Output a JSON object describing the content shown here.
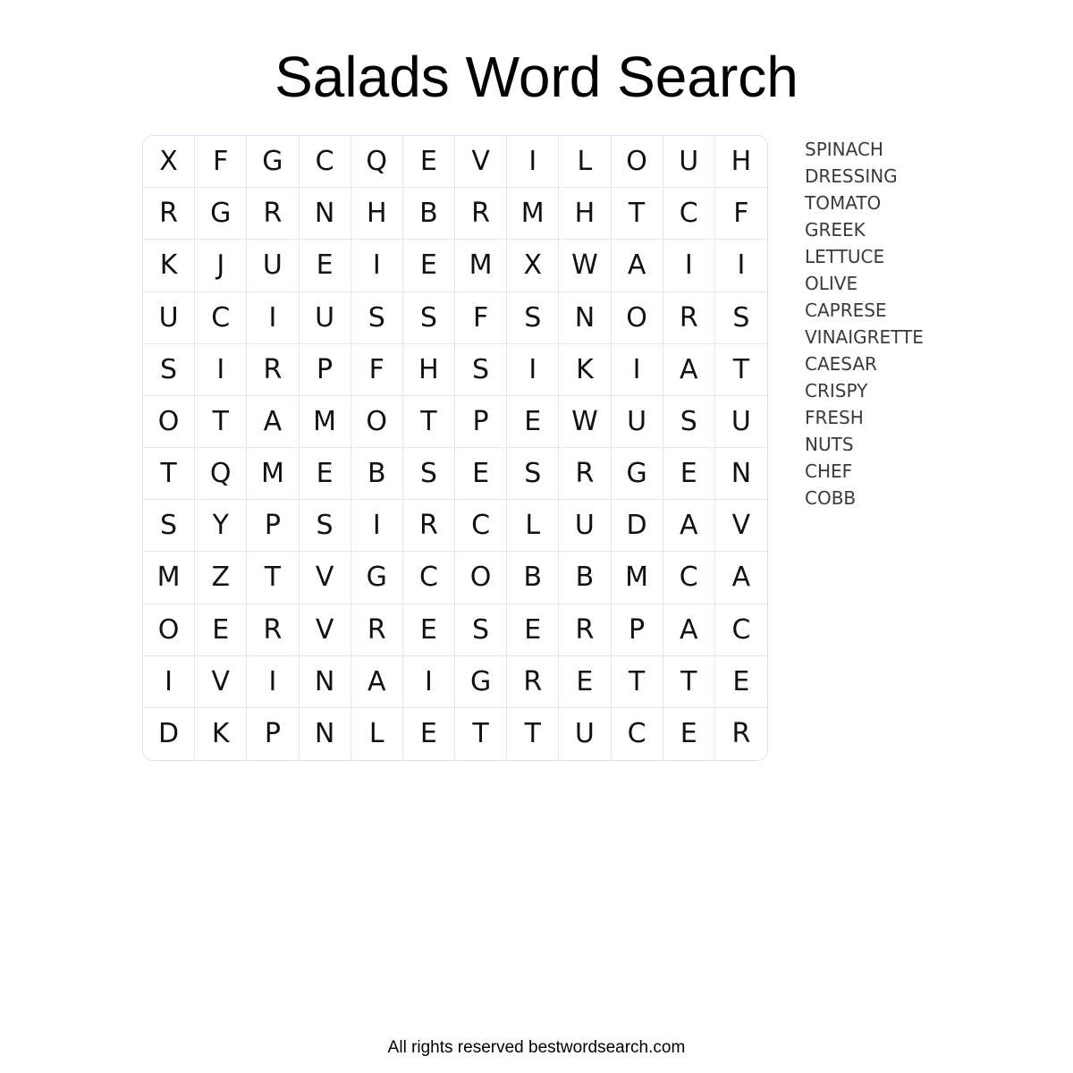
{
  "title": "Salads Word Search",
  "grid": [
    [
      "X",
      "F",
      "G",
      "C",
      "Q",
      "E",
      "V",
      "I",
      "L",
      "O",
      "U",
      "H"
    ],
    [
      "R",
      "G",
      "R",
      "N",
      "H",
      "B",
      "R",
      "M",
      "H",
      "T",
      "C",
      "F"
    ],
    [
      "K",
      "J",
      "U",
      "E",
      "I",
      "E",
      "M",
      "X",
      "W",
      "A",
      "I",
      "I"
    ],
    [
      "U",
      "C",
      "I",
      "U",
      "S",
      "S",
      "F",
      "S",
      "N",
      "O",
      "R",
      "S"
    ],
    [
      "S",
      "I",
      "R",
      "P",
      "F",
      "H",
      "S",
      "I",
      "K",
      "I",
      "A",
      "T"
    ],
    [
      "O",
      "T",
      "A",
      "M",
      "O",
      "T",
      "P",
      "E",
      "W",
      "U",
      "S",
      "U"
    ],
    [
      "T",
      "Q",
      "M",
      "E",
      "B",
      "S",
      "E",
      "S",
      "R",
      "G",
      "E",
      "N"
    ],
    [
      "S",
      "Y",
      "P",
      "S",
      "I",
      "R",
      "C",
      "L",
      "U",
      "D",
      "A",
      "V"
    ],
    [
      "M",
      "Z",
      "T",
      "V",
      "G",
      "C",
      "O",
      "B",
      "B",
      "M",
      "C",
      "A"
    ],
    [
      "O",
      "E",
      "R",
      "V",
      "R",
      "E",
      "S",
      "E",
      "R",
      "P",
      "A",
      "C"
    ],
    [
      "I",
      "V",
      "I",
      "N",
      "A",
      "I",
      "G",
      "R",
      "E",
      "T",
      "T",
      "E"
    ],
    [
      "D",
      "K",
      "P",
      "N",
      "L",
      "E",
      "T",
      "T",
      "U",
      "C",
      "E",
      "R"
    ]
  ],
  "words": [
    "SPINACH",
    "DRESSING",
    "TOMATO",
    "GREEK",
    "LETTUCE",
    "OLIVE",
    "CAPRESE",
    "VINAIGRETTE",
    "CAESAR",
    "CRISPY",
    "FRESH",
    "NUTS",
    "CHEF",
    "COBB"
  ],
  "footer": "All rights reserved bestwordsearch.com"
}
